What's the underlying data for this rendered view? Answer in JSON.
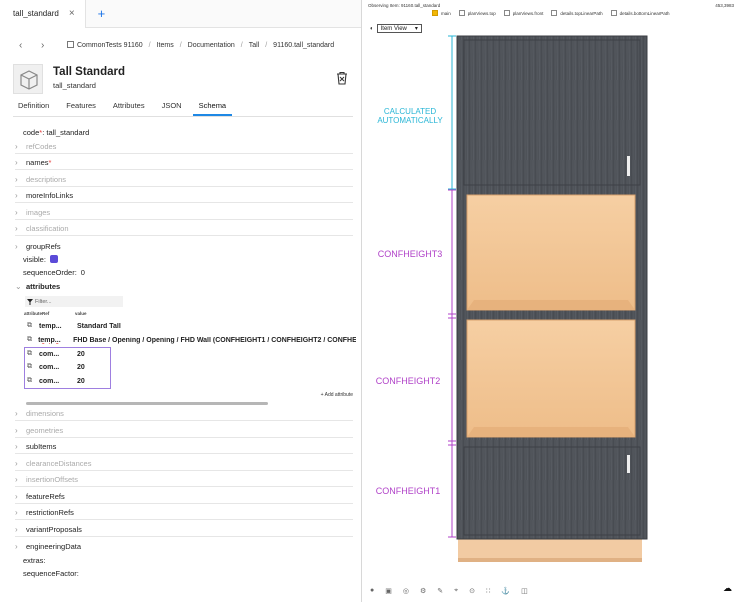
{
  "tab": {
    "title": "tall_standard",
    "close": "×",
    "add": "+"
  },
  "breadcrumb": [
    "CommonTests 91160",
    "Items",
    "Documentation",
    "Tall",
    "91160.tall_standard"
  ],
  "header": {
    "title": "Tall Standard",
    "subtitle": "tall_standard"
  },
  "subtabs": [
    "Definition",
    "Features",
    "Attributes",
    "JSON",
    "Schema"
  ],
  "active_subtab": "Schema",
  "schema": {
    "code_label": "code",
    "code_value": "tall_standard",
    "refCodes": "refCodes",
    "names": "names",
    "descriptions": "descriptions",
    "moreInfoLinks": "moreInfoLinks",
    "images": "images",
    "classification": "classification",
    "groupRefs": "groupRefs",
    "visible": "visible:",
    "sequenceOrder": "sequenceOrder:",
    "sequenceOrder_value": "0",
    "attributes": "attributes",
    "filter_placeholder": "Filter...",
    "col_ref": "attributeRef",
    "col_value": "value",
    "rows": [
      {
        "ref": "temp...",
        "value": "Standard Tall"
      },
      {
        "ref": "temp...",
        "value": "FHD Base / Opening / Opening / FHD Wall (CONFHEIGHT1 / CONFHEIGHT2 / CONFHEIGHT3)"
      },
      {
        "ref": "com...",
        "value": "20"
      },
      {
        "ref": "com...",
        "value": "20"
      },
      {
        "ref": "com...",
        "value": "20"
      }
    ],
    "add_attribute": "+ Add attribute",
    "dimensions": "dimensions",
    "geometries": "geometries",
    "subItems": "subItems",
    "clearanceDistances": "clearanceDistances",
    "insertionOffsets": "insertionOffsets",
    "featureRefs": "featureRefs",
    "restrictionRefs": "restrictionRefs",
    "variantProposals": "variantProposals",
    "engineeringData": "engineeringData",
    "extras": "extras:",
    "sequenceFactor": "sequenceFactor:"
  },
  "viewer": {
    "observing": "Observing Item: 91160.tall_standard",
    "coords": "453,3983",
    "layers": [
      {
        "label": "main",
        "checked": true
      },
      {
        "label": "planViews.top",
        "checked": false
      },
      {
        "label": "planViews.front",
        "checked": false
      },
      {
        "label": "details.topLinearPath",
        "checked": false
      },
      {
        "label": "details.bottomLinearPath",
        "checked": false
      }
    ],
    "view_select": "Item View",
    "dims": {
      "top": "CALCULATED AUTOMATICALLY",
      "h3": "CONFHEIGHT3",
      "h2": "CONFHEIGHT2",
      "h1": "CONFHEIGHT1"
    },
    "colors": {
      "cabinet": "#4e5258",
      "opening": "#f3c99a",
      "plinth": "#f2cba3",
      "top_dim": "#29b6d6",
      "conf_dim": "#b042c8"
    }
  }
}
